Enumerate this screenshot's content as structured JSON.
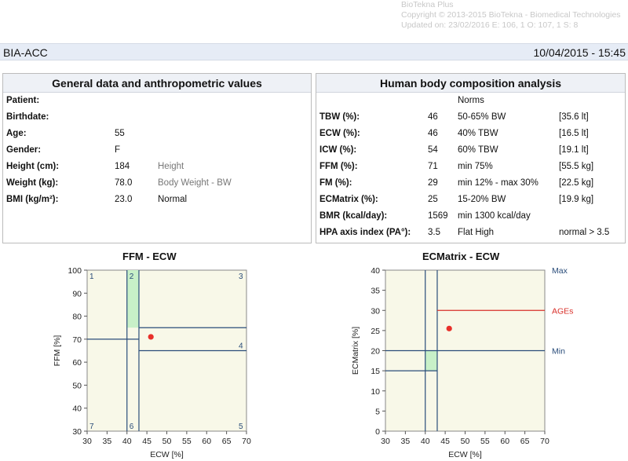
{
  "header": {
    "product": "BioTekna Plus",
    "copyright": "Copyright © 2013-2015 BioTekna - Biomedical Technologies",
    "updated": "Updated on: 23/02/2016 E: 106, 1 O: 107, 1 S: 8"
  },
  "title_bar": {
    "left": "BIA-ACC",
    "right": "10/04/2015 - 15:45"
  },
  "general": {
    "title": "General data and anthropometric values",
    "rows": [
      {
        "label": "Patient:",
        "value": "",
        "note": ""
      },
      {
        "label": "Birthdate:",
        "value": "",
        "note": ""
      },
      {
        "label": "Age:",
        "value": "55",
        "note": ""
      },
      {
        "label": "Gender:",
        "value": "F",
        "note": ""
      },
      {
        "label": "Height (cm):",
        "value": "184",
        "note": "Height"
      },
      {
        "label": "Weight (kg):",
        "value": "78.0",
        "note": "Body Weight - BW"
      },
      {
        "label": "BMI (kg/m²):",
        "value": "23.0",
        "note": "Normal"
      }
    ]
  },
  "composition": {
    "title": "Human body composition analysis",
    "norms_header": "Norms",
    "rows": [
      {
        "label": "TBW (%):",
        "value": "46",
        "norm": "50-65% BW",
        "extra": "[35.6 lt]"
      },
      {
        "label": "ECW (%):",
        "value": "46",
        "norm": "40% TBW",
        "extra": "[16.5 lt]"
      },
      {
        "label": "ICW (%):",
        "value": "54",
        "norm": "60% TBW",
        "extra": "[19.1 lt]"
      },
      {
        "label": "FFM (%):",
        "value": "71",
        "norm": "min 75%",
        "extra": "[55.5 kg]"
      },
      {
        "label": "FM (%):",
        "value": "29",
        "norm": "min 12% - max 30%",
        "extra": "[22.5 kg]"
      },
      {
        "label": "ECMatrix (%):",
        "value": "25",
        "norm": "15-20% BW",
        "extra": "[19.9 kg]"
      },
      {
        "label": "BMR (kcal/day):",
        "value": "1569",
        "norm": "min 1300 kcal/day",
        "extra": ""
      },
      {
        "label": "HPA axis index (PA°):",
        "value": "3.5",
        "norm": "Flat High",
        "extra": "normal > 3.5"
      }
    ]
  },
  "chart_data": [
    {
      "type": "scatter",
      "title": "FFM - ECW",
      "xlabel": "ECW [%]",
      "ylabel": "FFM [%]",
      "xlim": [
        30,
        70
      ],
      "ylim": [
        30,
        100
      ],
      "xticks": [
        "30",
        "35",
        "40",
        "45",
        "50",
        "55",
        "60",
        "65",
        "70"
      ],
      "yticks": [
        "30",
        "40",
        "50",
        "60",
        "70",
        "80",
        "90",
        "100"
      ],
      "background_color": "#f8f8e8",
      "line_color": "#2a4d7a",
      "highlight_color": "#c8f0c8",
      "point_color": "#e8302a",
      "zones": [
        "1",
        "2",
        "3",
        "4",
        "5",
        "6",
        "7"
      ],
      "point": {
        "x": 46,
        "y": 71
      }
    },
    {
      "type": "scatter",
      "title": "ECMatrix - ECW",
      "xlabel": "ECW [%]",
      "ylabel": "ECMatrix [%]",
      "xlim": [
        30,
        70
      ],
      "ylim": [
        0,
        40
      ],
      "xticks": [
        "30",
        "35",
        "40",
        "45",
        "50",
        "55",
        "60",
        "65",
        "70"
      ],
      "yticks": [
        "0",
        "5",
        "10",
        "15",
        "20",
        "25",
        "30",
        "35",
        "40"
      ],
      "background_color": "#f8f8e8",
      "line_color": "#2a4d7a",
      "ages_color": "#d9302a",
      "highlight_color": "#c8f0c8",
      "point_color": "#e8302a",
      "right_labels": [
        "Max",
        "AGEs",
        "Min"
      ],
      "point": {
        "x": 46,
        "y": 25.5
      }
    }
  ]
}
